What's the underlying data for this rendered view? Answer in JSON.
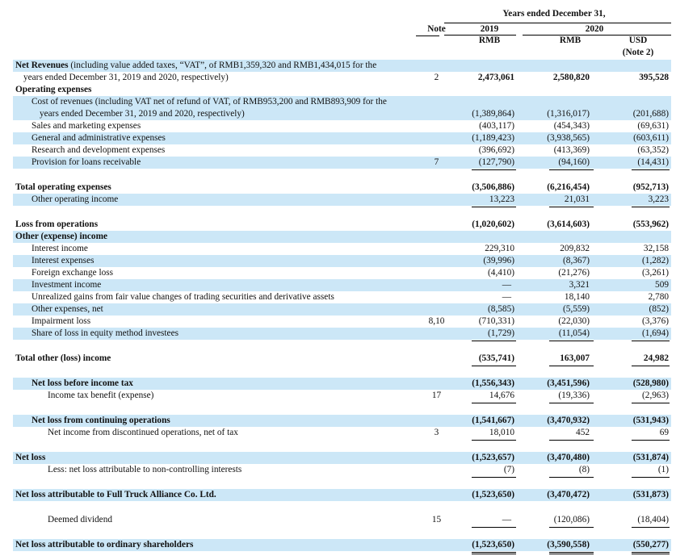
{
  "header": {
    "note": "Note",
    "years_ended": "Years ended December 31,",
    "year_2019": "2019",
    "year_2020": "2020",
    "col_rmb_2019": "RMB",
    "col_rmb_2020": "RMB",
    "col_usd": "USD",
    "col_usd_note": "(Note 2)"
  },
  "rows": [
    {
      "label": "Net Revenues",
      "label_rest": " (including value added taxes, “VAT”, of RMB1,359,320 and RMB1,434,015 for the",
      "label2": "years ended December 31, 2019 and 2020, respectively)",
      "note": "2",
      "v": [
        "2,473,061",
        "2,580,820",
        "395,528"
      ]
    },
    {
      "label": "Operating expenses"
    },
    {
      "label": "Cost of revenues (including VAT net of refund of VAT, of RMB953,200 and RMB893,909 for the",
      "label2": "years ended December 31, 2019 and 2020, respectively)",
      "v": [
        "(1,389,864)",
        "(1,316,017)",
        "(201,688)"
      ]
    },
    {
      "label": "Sales and marketing expenses",
      "v": [
        "(403,117)",
        "(454,343)",
        "(69,631)"
      ]
    },
    {
      "label": "General and administrative expenses",
      "v": [
        "(1,189,423)",
        "(3,938,565)",
        "(603,611)"
      ]
    },
    {
      "label": "Research and development expenses",
      "v": [
        "(396,692)",
        "(413,369)",
        "(63,352)"
      ]
    },
    {
      "label": "Provision for loans receivable",
      "note": "7",
      "v": [
        "(127,790)",
        "(94,160)",
        "(14,431)"
      ]
    },
    {
      "label": "Total operating expenses",
      "v": [
        "(3,506,886)",
        "(6,216,454)",
        "(952,713)"
      ]
    },
    {
      "label": "Other operating income",
      "v": [
        "13,223",
        "21,031",
        "3,223"
      ]
    },
    {
      "label": "Loss from operations",
      "v": [
        "(1,020,602)",
        "(3,614,603)",
        "(553,962)"
      ]
    },
    {
      "label": "Other (expense) income"
    },
    {
      "label": "Interest income",
      "v": [
        "229,310",
        "209,832",
        "32,158"
      ]
    },
    {
      "label": "Interest expenses",
      "v": [
        "(39,996)",
        "(8,367)",
        "(1,282)"
      ]
    },
    {
      "label": "Foreign exchange loss",
      "v": [
        "(4,410)",
        "(21,276)",
        "(3,261)"
      ]
    },
    {
      "label": "Investment income",
      "v": [
        "—",
        "3,321",
        "509"
      ]
    },
    {
      "label": "Unrealized gains from fair value changes of trading securities and derivative assets",
      "v": [
        "—",
        "18,140",
        "2,780"
      ]
    },
    {
      "label": "Other expenses, net",
      "v": [
        "(8,585)",
        "(5,559)",
        "(852)"
      ]
    },
    {
      "label": "Impairment loss",
      "note": "8,10",
      "v": [
        "(710,331)",
        "(22,030)",
        "(3,376)"
      ]
    },
    {
      "label": "Share of loss in equity method investees",
      "v": [
        "(1,729)",
        "(11,054)",
        "(1,694)"
      ]
    },
    {
      "label": "Total other (loss) income",
      "v": [
        "(535,741)",
        "163,007",
        "24,982"
      ]
    },
    {
      "label": "Net loss before income tax",
      "v": [
        "(1,556,343)",
        "(3,451,596)",
        "(528,980)"
      ]
    },
    {
      "label": "Income tax benefit (expense)",
      "note": "17",
      "v": [
        "14,676",
        "(19,336)",
        "(2,963)"
      ]
    },
    {
      "label": "Net loss from continuing operations",
      "v": [
        "(1,541,667)",
        "(3,470,932)",
        "(531,943)"
      ]
    },
    {
      "label": "Net income from discontinued operations, net of tax",
      "note": "3",
      "v": [
        "18,010",
        "452",
        "69"
      ]
    },
    {
      "label": "Net loss",
      "v": [
        "(1,523,657)",
        "(3,470,480)",
        "(531,874)"
      ]
    },
    {
      "label": "Less: net loss attributable to non-controlling interests",
      "v": [
        "(7)",
        "(8)",
        "(1)"
      ]
    },
    {
      "label": "Net loss attributable to Full Truck Alliance Co. Ltd.",
      "v": [
        "(1,523,650)",
        "(3,470,472)",
        "(531,873)"
      ]
    },
    {
      "label": "Deemed dividend",
      "note": "15",
      "v": [
        "—",
        "(120,086)",
        "(18,404)"
      ]
    },
    {
      "label": "Net loss attributable to ordinary shareholders",
      "v": [
        "(1,523,650)",
        "(3,590,558)",
        "(550,277)"
      ]
    }
  ]
}
